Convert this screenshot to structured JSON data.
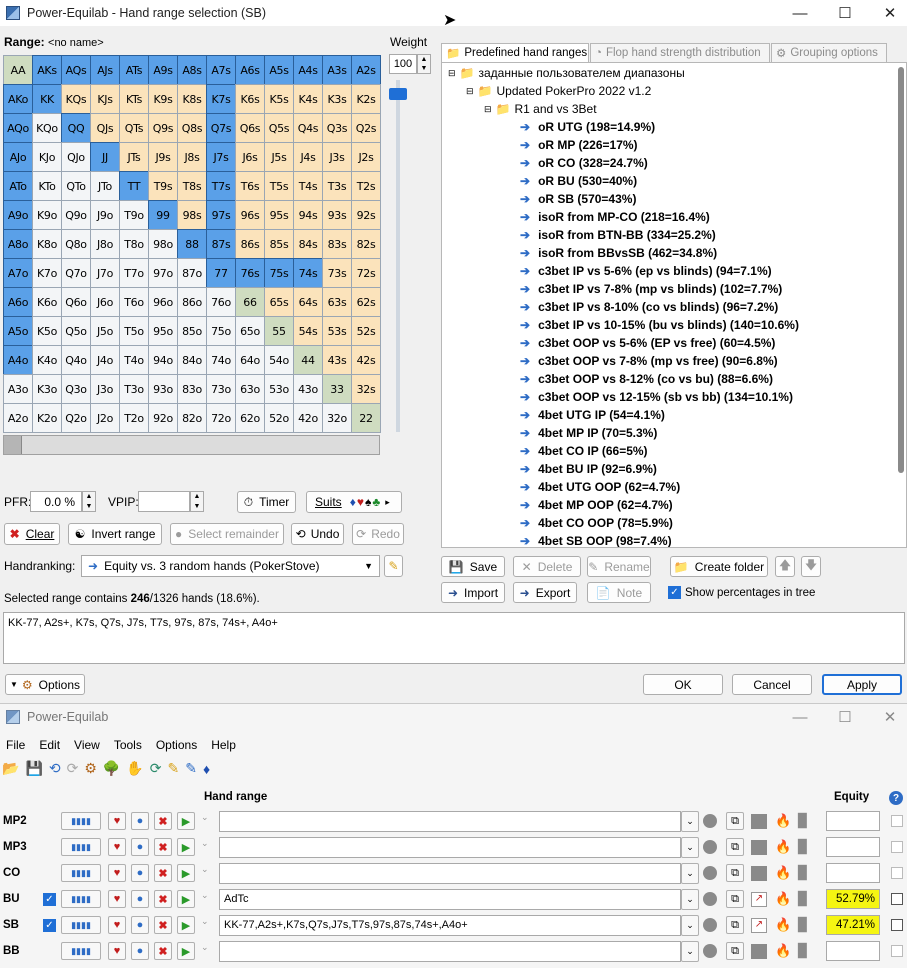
{
  "dialog": {
    "title": "Power-Equilab - Hand range selection (SB)",
    "range_label": "Range:",
    "range_name": "<no name>",
    "weight_label": "Weight",
    "weight_value": "100",
    "grid": [
      [
        "AA",
        "AKs",
        "AQs",
        "AJs",
        "ATs",
        "A9s",
        "A8s",
        "A7s",
        "A6s",
        "A5s",
        "A4s",
        "A3s",
        "A2s"
      ],
      [
        "AKo",
        "KK",
        "KQs",
        "KJs",
        "KTs",
        "K9s",
        "K8s",
        "K7s",
        "K6s",
        "K5s",
        "K4s",
        "K3s",
        "K2s"
      ],
      [
        "AQo",
        "KQo",
        "QQ",
        "QJs",
        "QTs",
        "Q9s",
        "Q8s",
        "Q7s",
        "Q6s",
        "Q5s",
        "Q4s",
        "Q3s",
        "Q2s"
      ],
      [
        "AJo",
        "KJo",
        "QJo",
        "JJ",
        "JTs",
        "J9s",
        "J8s",
        "J7s",
        "J6s",
        "J5s",
        "J4s",
        "J3s",
        "J2s"
      ],
      [
        "ATo",
        "KTo",
        "QTo",
        "JTo",
        "TT",
        "T9s",
        "T8s",
        "T7s",
        "T6s",
        "T5s",
        "T4s",
        "T3s",
        "T2s"
      ],
      [
        "A9o",
        "K9o",
        "Q9o",
        "J9o",
        "T9o",
        "99",
        "98s",
        "97s",
        "96s",
        "95s",
        "94s",
        "93s",
        "92s"
      ],
      [
        "A8o",
        "K8o",
        "Q8o",
        "J8o",
        "T8o",
        "98o",
        "88",
        "87s",
        "86s",
        "85s",
        "84s",
        "83s",
        "82s"
      ],
      [
        "A7o",
        "K7o",
        "Q7o",
        "J7o",
        "T7o",
        "97o",
        "87o",
        "77",
        "76s",
        "75s",
        "74s",
        "73s",
        "72s"
      ],
      [
        "A6o",
        "K6o",
        "Q6o",
        "J6o",
        "T6o",
        "96o",
        "86o",
        "76o",
        "66",
        "65s",
        "64s",
        "63s",
        "62s"
      ],
      [
        "A5o",
        "K5o",
        "Q5o",
        "J5o",
        "T5o",
        "95o",
        "85o",
        "75o",
        "65o",
        "55",
        "54s",
        "53s",
        "52s"
      ],
      [
        "A4o",
        "K4o",
        "Q4o",
        "J4o",
        "T4o",
        "94o",
        "84o",
        "74o",
        "64o",
        "54o",
        "44",
        "43s",
        "42s"
      ],
      [
        "A3o",
        "K3o",
        "Q3o",
        "J3o",
        "T3o",
        "93o",
        "83o",
        "73o",
        "63o",
        "53o",
        "43o",
        "33",
        "32s"
      ],
      [
        "A2o",
        "K2o",
        "Q2o",
        "J2o",
        "T2o",
        "92o",
        "82o",
        "72o",
        "62o",
        "52o",
        "42o",
        "32o",
        "22"
      ]
    ],
    "selected_hands": [
      "AKs",
      "AQs",
      "AJs",
      "ATs",
      "A9s",
      "A8s",
      "A7s",
      "A6s",
      "A5s",
      "A4s",
      "A3s",
      "A2s",
      "AKo",
      "KK",
      "K7s",
      "AQo",
      "QQ",
      "Q7s",
      "AJo",
      "JJ",
      "J7s",
      "ATo",
      "TT",
      "T7s",
      "A9o",
      "99",
      "97s",
      "A8o",
      "88",
      "87s",
      "A7o",
      "77",
      "76s",
      "75s",
      "74s",
      "A6o",
      "A5o",
      "A4o"
    ],
    "tabs": [
      {
        "label": "Predefined hand ranges",
        "icon": "folder-icon"
      },
      {
        "label": "Flop hand strength distribution",
        "icon": "pie-icon"
      },
      {
        "label": "Grouping options",
        "icon": "people-icon"
      }
    ],
    "tree": {
      "root": "заданные пользователем диапазоны",
      "group": "Updated PokerPro 2022 v1.2",
      "subgroup": "R1 and vs 3Bet",
      "items": [
        "oR UTG (198=14.9%)",
        "oR MP (226=17%)",
        "oR CO (328=24.7%)",
        "oR BU (530=40%)",
        "oR SB (570=43%)",
        "isoR from MP-CO (218=16.4%)",
        "isoR from BTN-BB (334=25.2%)",
        "isoR from BBvsSB (462=34.8%)",
        "c3bet IP vs 5-6% (ep vs blinds) (94=7.1%)",
        "c3bet IP vs 7-8% (mp vs blinds) (102=7.7%)",
        "c3bet IP vs 8-10% (co vs blinds) (96=7.2%)",
        "c3bet IP vs 10-15% (bu vs blinds) (140=10.6%)",
        "c3bet OOP vs 5-6% (EP vs free) (60=4.5%)",
        "c3bet OOP vs 7-8% (mp vs free) (90=6.8%)",
        "c3bet OOP vs 8-12% (co vs bu) (88=6.6%)",
        "c3bet OOP vs 12-15% (sb vs bb) (134=10.1%)",
        "4bet UTG IP (54=4.1%)",
        "4bet MP IP (70=5.3%)",
        "4bet CO IP (66=5%)",
        "4bet BU IP (92=6.9%)",
        "4bet UTG OOP (62=4.7%)",
        "4bet MP OOP (62=4.7%)",
        "4bet CO OOP (78=5.9%)",
        "4bet SB OOP (98=7.4%)"
      ]
    },
    "pfr_label": "PFR:",
    "pfr_value": "0.0 %",
    "vpip_label": "VPIP:",
    "vpip_value": "",
    "timer_label": "Timer",
    "suits_label": "Suits",
    "suit_symbols": "♦♥♠♣",
    "clear_label": "Clear",
    "invert_label": "Invert range",
    "select_remainder_label": "Select remainder",
    "undo_label": "Undo",
    "redo_label": "Redo",
    "handranking_label": "Handranking:",
    "handranking_value": "Equity vs. 3 random hands (PokerStove)",
    "tree_buttons": {
      "save": "Save",
      "delete": "Delete",
      "rename": "Rename",
      "create_folder": "Create folder",
      "import": "Import",
      "export": "Export",
      "note": "Note",
      "show_pct": "Show percentages in tree"
    },
    "summary_prefix": "Selected range contains ",
    "summary_count": "246",
    "summary_suffix": "/1326 hands (18.6%).",
    "range_text": "KK-77, A2s+, K7s, Q7s, J7s, T7s, 97s, 87s, 74s+, A4o+",
    "options_label": "Options",
    "ok_label": "OK",
    "cancel_label": "Cancel",
    "apply_label": "Apply"
  },
  "main": {
    "title": "Power-Equilab",
    "menu": [
      "File",
      "Edit",
      "View",
      "Tools",
      "Options",
      "Help"
    ],
    "hand_range_header": "Hand range",
    "equity_header": "Equity",
    "help_icon": "?",
    "players": [
      {
        "name": "MP2",
        "checked": false,
        "range": "",
        "equity": ""
      },
      {
        "name": "MP3",
        "checked": false,
        "range": "",
        "equity": ""
      },
      {
        "name": "CO",
        "checked": false,
        "range": "",
        "equity": ""
      },
      {
        "name": "BU",
        "checked": true,
        "range": "AdTc",
        "equity": "52.79%"
      },
      {
        "name": "SB",
        "checked": true,
        "range": "KK-77,A2s+,K7s,Q7s,J7s,T7s,97s,87s,74s+,A4o+",
        "equity": "47.21%"
      },
      {
        "name": "BB",
        "checked": false,
        "range": "",
        "equity": ""
      }
    ]
  },
  "colors": {
    "selected": "#5aa0e8",
    "suited": "#fbe3bb",
    "offsuit": "#f3f5f7",
    "pair": "#cfdcc0",
    "equity_highlight": "#f5f512"
  }
}
